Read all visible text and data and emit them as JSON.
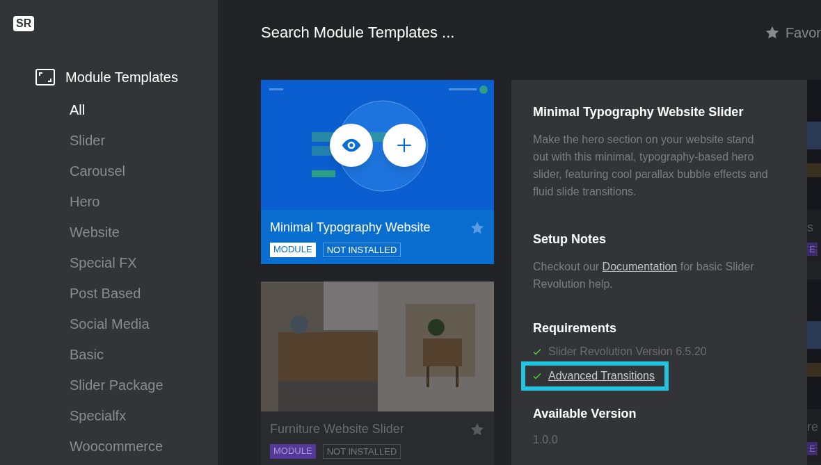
{
  "logo": "SR",
  "sidebar": {
    "heading": "Module Templates",
    "items": [
      {
        "label": "All",
        "selected": true
      },
      {
        "label": "Slider",
        "selected": false
      },
      {
        "label": "Carousel",
        "selected": false
      },
      {
        "label": "Hero",
        "selected": false
      },
      {
        "label": "Website",
        "selected": false
      },
      {
        "label": "Special FX",
        "selected": false
      },
      {
        "label": "Post Based",
        "selected": false
      },
      {
        "label": "Social Media",
        "selected": false
      },
      {
        "label": "Basic",
        "selected": false
      },
      {
        "label": "Slider Package",
        "selected": false
      },
      {
        "label": "Specialfx",
        "selected": false
      },
      {
        "label": "Woocommerce",
        "selected": false
      }
    ]
  },
  "search": {
    "placeholder": "Search Module Templates ..."
  },
  "favorites": {
    "label": "Favor"
  },
  "cards": [
    {
      "title": "Minimal Typography Website",
      "highlighted": true,
      "badges": [
        "MODULE",
        "NOT INSTALLED"
      ]
    },
    {
      "title": "Furniture Website Slider",
      "highlighted": false,
      "badges": [
        "MODULE",
        "NOT INSTALLED"
      ]
    }
  ],
  "details": {
    "title": "Minimal Typography Website Slider",
    "description": "Make the hero section on your website stand out with this minimal, typography-based hero slider, featuring cool parallax bubble effects and fluid slide transitions.",
    "setup_heading": "Setup Notes",
    "setup_before": "Checkout our ",
    "setup_link": "Documentation",
    "setup_after": " for basic Slider Revolution help.",
    "requirements_heading": "Requirements",
    "requirements": [
      {
        "label": "Slider Revolution Version 6.5.20",
        "met": true,
        "highlighted": false
      },
      {
        "label": "Advanced Transitions",
        "met": true,
        "highlighted": true
      }
    ],
    "version_heading": "Available Version",
    "version": "1.0.0"
  },
  "side_cards": [
    {
      "title": "s",
      "badge": "E"
    },
    {
      "title": "re",
      "badge": "E"
    }
  ]
}
